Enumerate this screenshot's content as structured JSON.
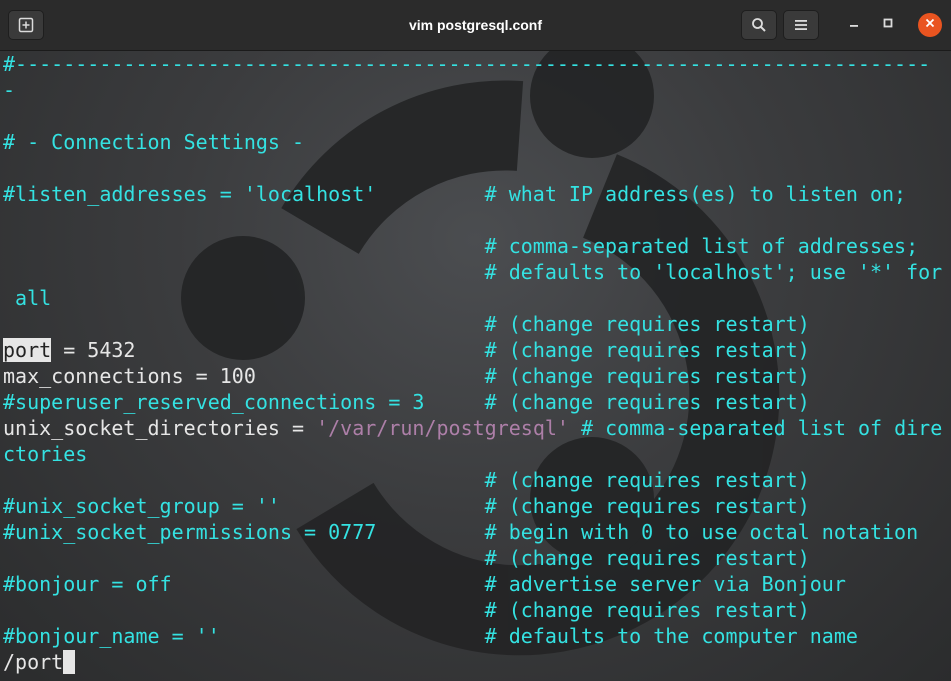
{
  "window": {
    "title": "vim postgresql.conf",
    "accent_close": "#e95420"
  },
  "header_buttons": {
    "new_tab_icon": "new-tab-icon",
    "search_icon": "search-icon",
    "menu_icon": "hamburger-menu-icon"
  },
  "colors": {
    "comment": "#34e2e2",
    "text": "#e6e6e6",
    "string": "#ad7fa8"
  },
  "editor": {
    "lines": [
      {
        "segments": [
          {
            "type": "comment",
            "text": "#----------------------------------------------------------------------------"
          }
        ]
      },
      {
        "segments": [
          {
            "type": "comment",
            "text": "-"
          }
        ]
      },
      {
        "segments": []
      },
      {
        "segments": [
          {
            "type": "comment",
            "text": "# - Connection Settings -"
          }
        ]
      },
      {
        "segments": []
      },
      {
        "segments": [
          {
            "type": "comment",
            "text": "#listen_addresses = 'localhost'         # what IP address(es) to listen on;"
          }
        ]
      },
      {
        "segments": []
      },
      {
        "segments": [
          {
            "type": "comment",
            "text": "                                        # comma-separated list of addresses;"
          }
        ]
      },
      {
        "segments": [
          {
            "type": "comment",
            "text": "                                        # defaults to 'localhost'; use '*' for"
          }
        ]
      },
      {
        "segments": [
          {
            "type": "comment",
            "text": " all"
          }
        ]
      },
      {
        "segments": [
          {
            "type": "comment",
            "text": "                                        # (change requires restart)"
          }
        ]
      },
      {
        "segments": [
          {
            "type": "hl",
            "text": "port"
          },
          {
            "type": "text",
            "text": " = 5432                             "
          },
          {
            "type": "comment",
            "text": "# (change requires restart)"
          }
        ]
      },
      {
        "segments": [
          {
            "type": "text",
            "text": "max_connections = 100                   "
          },
          {
            "type": "comment",
            "text": "# (change requires restart)"
          }
        ]
      },
      {
        "segments": [
          {
            "type": "comment",
            "text": "#superuser_reserved_connections = 3     # (change requires restart)"
          }
        ]
      },
      {
        "segments": [
          {
            "type": "text",
            "text": "unix_socket_directories = "
          },
          {
            "type": "string",
            "text": "'/var/run/postgresql'"
          },
          {
            "type": "text",
            "text": " "
          },
          {
            "type": "comment",
            "text": "# comma-separated list of dire"
          }
        ]
      },
      {
        "segments": [
          {
            "type": "comment",
            "text": "ctories"
          }
        ]
      },
      {
        "segments": [
          {
            "type": "comment",
            "text": "                                        # (change requires restart)"
          }
        ]
      },
      {
        "segments": [
          {
            "type": "comment",
            "text": "#unix_socket_group = ''                 # (change requires restart)"
          }
        ]
      },
      {
        "segments": [
          {
            "type": "comment",
            "text": "#unix_socket_permissions = 0777         # begin with 0 to use octal notation"
          }
        ]
      },
      {
        "segments": [
          {
            "type": "comment",
            "text": "                                        # (change requires restart)"
          }
        ]
      },
      {
        "segments": [
          {
            "type": "comment",
            "text": "#bonjour = off                          # advertise server via Bonjour"
          }
        ]
      },
      {
        "segments": [
          {
            "type": "comment",
            "text": "                                        # (change requires restart)"
          }
        ]
      },
      {
        "segments": [
          {
            "type": "comment",
            "text": "#bonjour_name = ''                      # defaults to the computer name"
          }
        ]
      }
    ],
    "command_line": "/port"
  }
}
